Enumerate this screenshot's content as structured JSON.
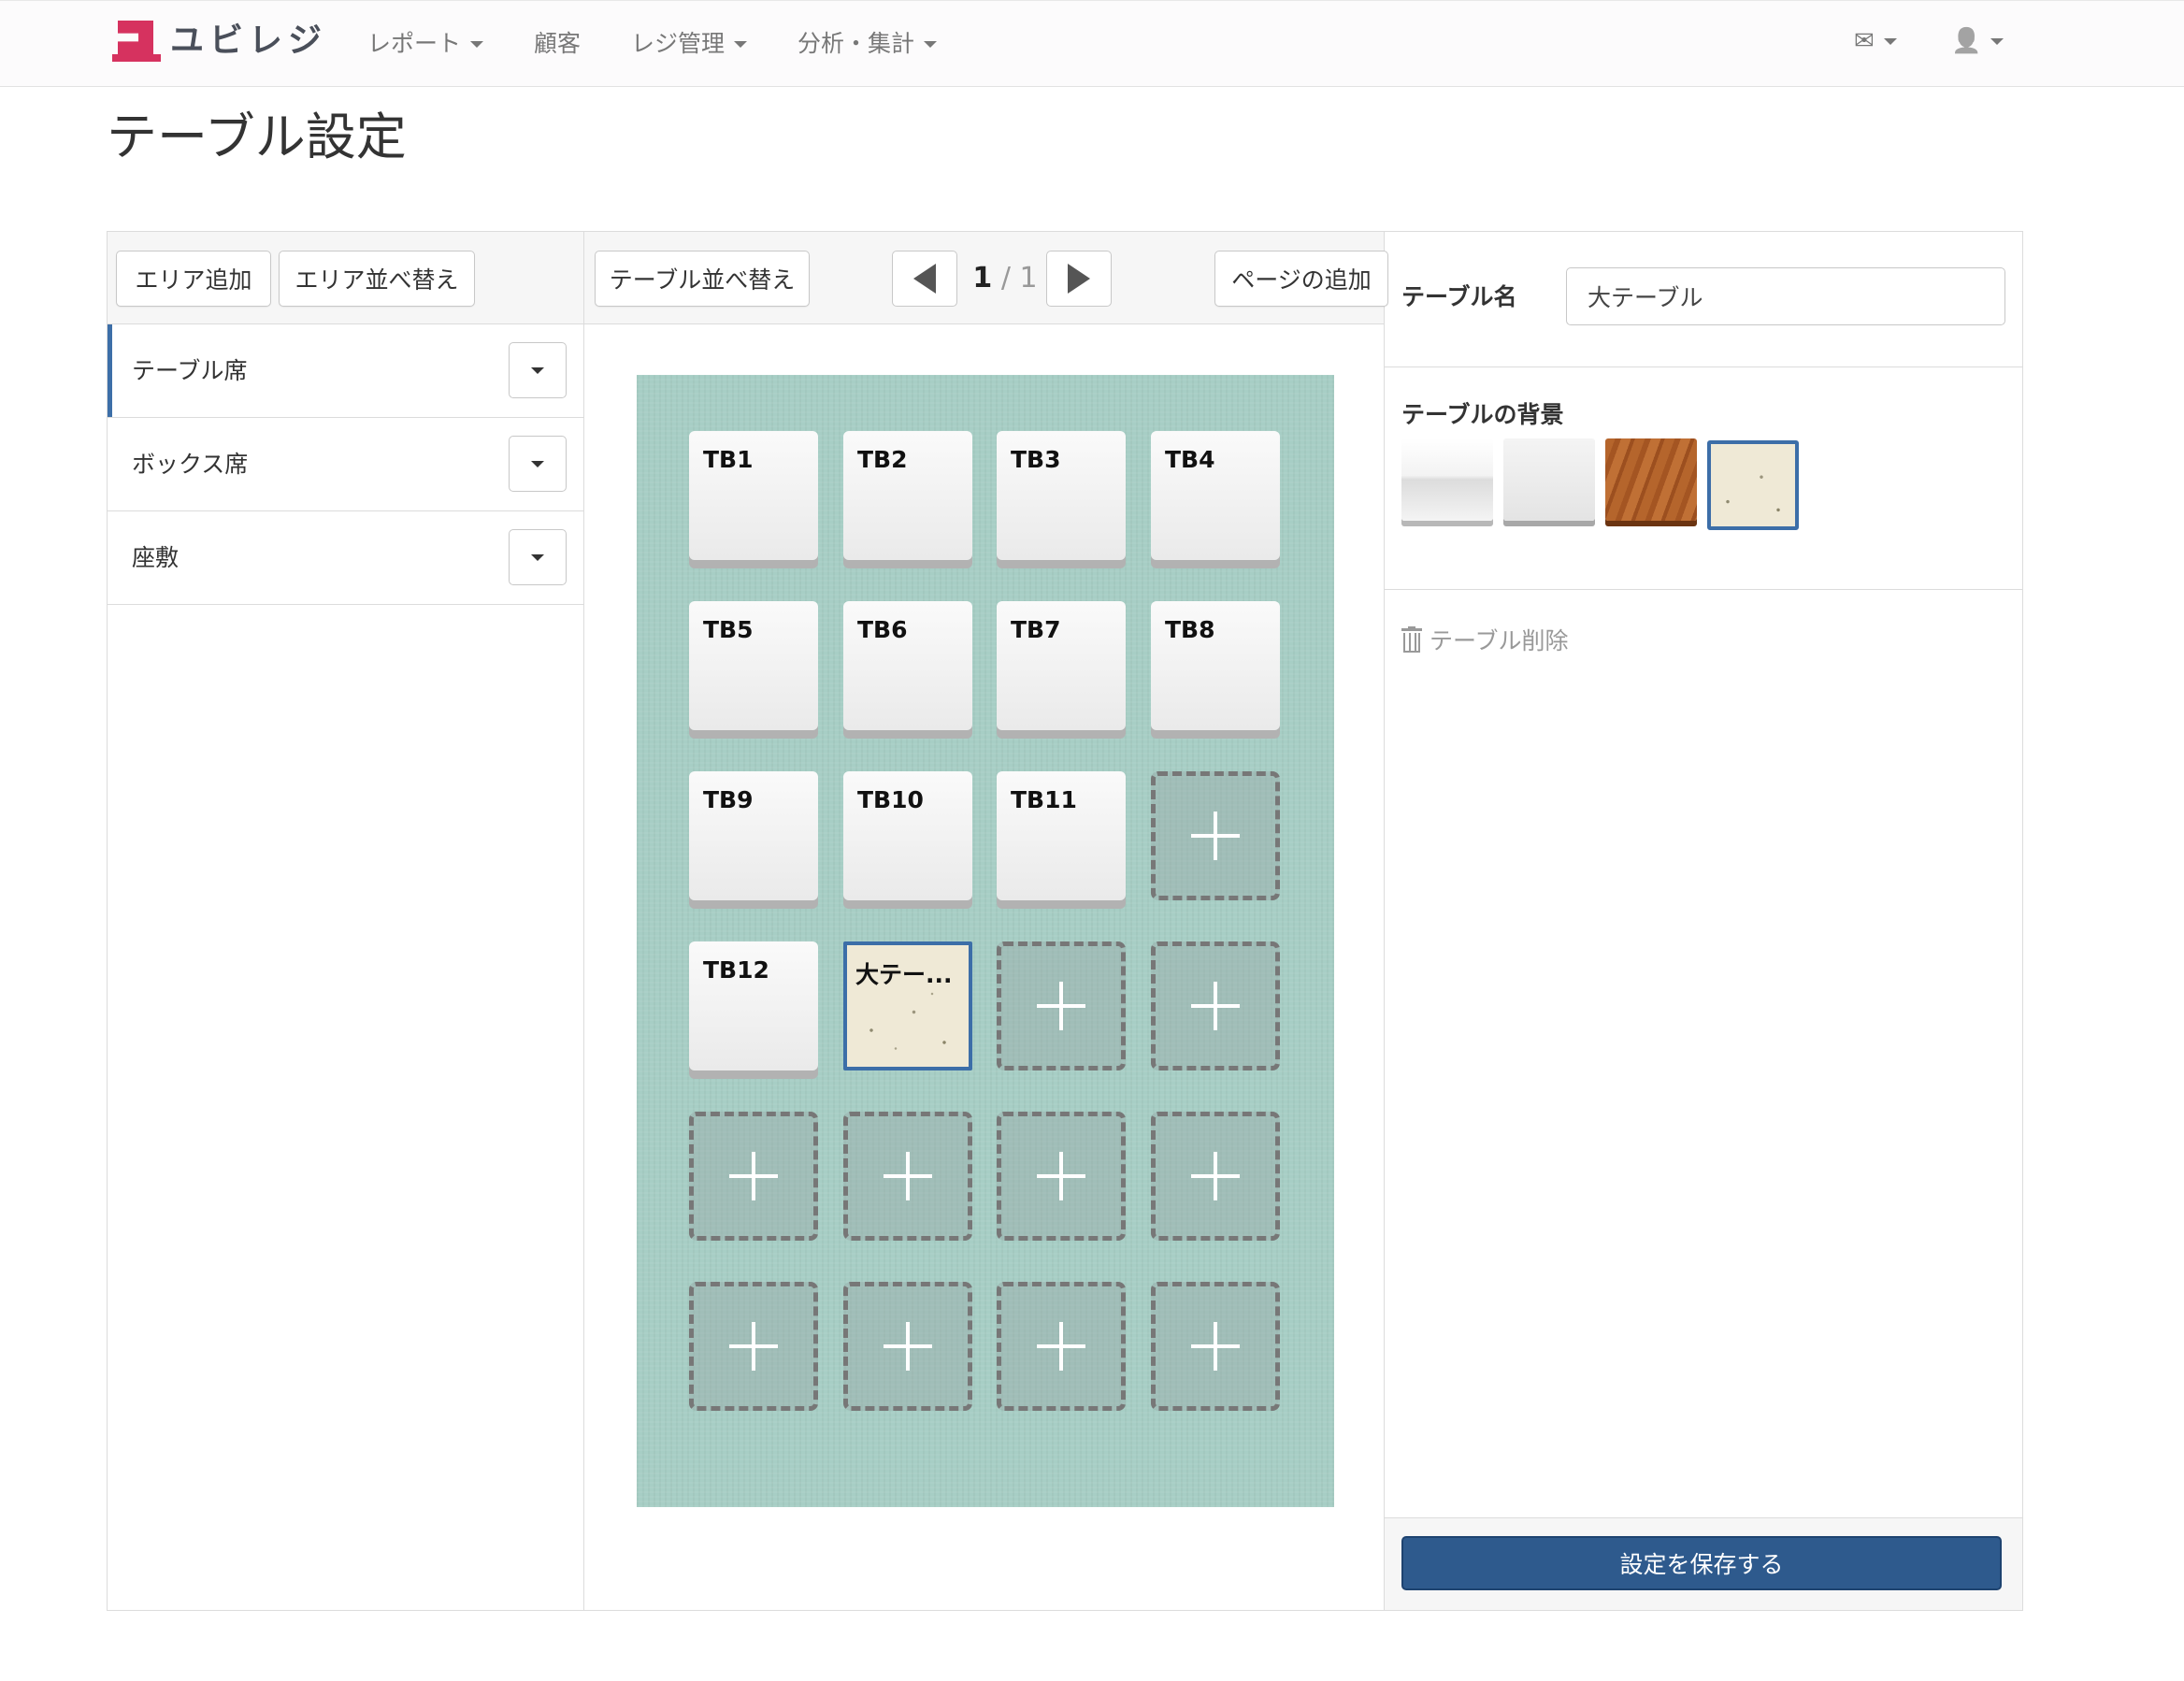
{
  "app": {
    "logo_text": "ユビレジ"
  },
  "nav": {
    "items": [
      {
        "label": "レポート",
        "dropdown": true
      },
      {
        "label": "顧客",
        "dropdown": false
      },
      {
        "label": "レジ管理",
        "dropdown": true
      },
      {
        "label": "分析・集計",
        "dropdown": true
      }
    ],
    "mail_icon": "✉",
    "user_icon": "👤"
  },
  "page": {
    "title": "テーブル設定"
  },
  "left": {
    "add_area_label": "エリア追加",
    "sort_area_label": "エリア並べ替え",
    "areas": [
      {
        "label": "テーブル席",
        "active": true
      },
      {
        "label": "ボックス席",
        "active": false
      },
      {
        "label": "座敷",
        "active": false
      }
    ]
  },
  "middle": {
    "sort_tables_label": "テーブル並べ替え",
    "pager": {
      "current": "1",
      "separator": "/",
      "total": "1"
    },
    "add_page_label": "ページの追加",
    "grid": [
      [
        "TB1",
        "TB2",
        "TB3",
        "TB4"
      ],
      [
        "TB5",
        "TB6",
        "TB7",
        "TB8"
      ],
      [
        "TB9",
        "TB10",
        "TB11",
        ""
      ],
      [
        "TB12",
        "大テー...",
        "",
        ""
      ],
      [
        "",
        "",
        "",
        ""
      ],
      [
        "",
        "",
        "",
        ""
      ]
    ],
    "selected_cell": "大テー..."
  },
  "right": {
    "table_name_label": "テーブル名",
    "table_name_value": "大テーブル",
    "background_label": "テーブルの背景",
    "backgrounds": [
      "white-glossy",
      "white-matte",
      "wood",
      "paper"
    ],
    "selected_background": "paper",
    "delete_label": "テーブル削除",
    "save_label": "設定を保存する"
  },
  "colors": {
    "accent": "#3c6ea8",
    "save_button": "#2e5a8d",
    "board": "#a7cec5",
    "brand": "#d6325f"
  }
}
